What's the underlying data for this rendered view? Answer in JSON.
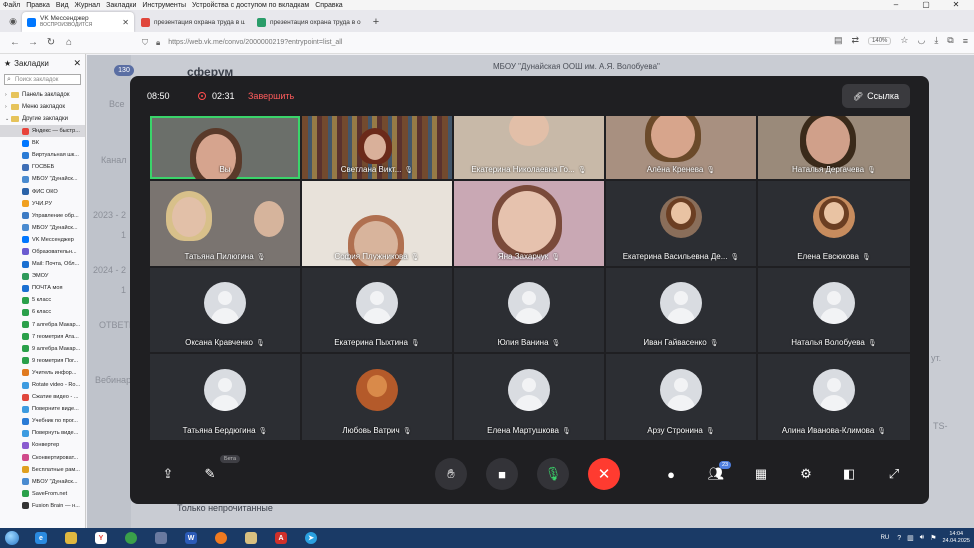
{
  "menubar": {
    "items": [
      "Файл",
      "Правка",
      "Вид",
      "Журнал",
      "Закладки",
      "Инструменты",
      "Устройства с доступом по вкладкам",
      "Справка"
    ]
  },
  "tabs": [
    {
      "title": "VK Мессенджер",
      "subtitle": "ВОСПРОИЗВОДИТСЯ",
      "color": "#0077ff"
    },
    {
      "title": "презентация охрана труда в ш...",
      "subtitle": "",
      "color": "#e0463c"
    },
    {
      "title": "презентация охрана труда в ош...",
      "subtitle": "",
      "color": "#2a9d6a"
    }
  ],
  "navbar": {
    "url": "https://web.vk.me/convo/2000000219?entrypoint=list_all",
    "zoom": "140%"
  },
  "sidebar": {
    "title": "Закладки",
    "search_placeholder": "Поиск закладок",
    "folders": [
      "Панель закладок",
      "Меню закладок",
      "Другие закладки"
    ],
    "items": [
      {
        "label": "Яндекс — быстр...",
        "color": "#e8433a"
      },
      {
        "label": "ВК",
        "color": "#0077ff"
      },
      {
        "label": "Виртуальная шк...",
        "color": "#2a7bd5"
      },
      {
        "label": "ГОСВЕБ",
        "color": "#3f6fb5"
      },
      {
        "label": "МБОУ \"Дунайск...",
        "color": "#4a8bd0"
      },
      {
        "label": "ФИС ОКО",
        "color": "#2b63a8"
      },
      {
        "label": "УЧИ.РУ",
        "color": "#f0a020"
      },
      {
        "label": "Управление обр...",
        "color": "#3d7bc4"
      },
      {
        "label": "МБОУ \"Дунайск...",
        "color": "#4a8bd0"
      },
      {
        "label": "VK Мессенджер",
        "color": "#0077ff"
      },
      {
        "label": "Образовательн...",
        "color": "#6b5bd0"
      },
      {
        "label": "Mail: Почта, Обл...",
        "color": "#1a6fd1"
      },
      {
        "label": "ЭМОУ",
        "color": "#2f9a5a"
      },
      {
        "label": "ПОЧТА моя",
        "color": "#1a6fd1"
      },
      {
        "label": "5 класс",
        "color": "#2aa04a"
      },
      {
        "label": "6 класс",
        "color": "#2aa04a"
      },
      {
        "label": "7 алгебра Макар...",
        "color": "#2aa04a"
      },
      {
        "label": "7 геометрия Ата...",
        "color": "#2aa04a"
      },
      {
        "label": "9 алгебра Макар...",
        "color": "#2aa04a"
      },
      {
        "label": "9 геометрия Пог...",
        "color": "#2aa04a"
      },
      {
        "label": "Учитель инфор...",
        "color": "#e07a20"
      },
      {
        "label": "Rotate video - Ro...",
        "color": "#3d9be0"
      },
      {
        "label": "Сжатие видео - ...",
        "color": "#e0463c"
      },
      {
        "label": "Поверните виде...",
        "color": "#3d9be0"
      },
      {
        "label": "Учебник по прог...",
        "color": "#2a7bd5"
      },
      {
        "label": "Повернуть виде...",
        "color": "#3d9be0"
      },
      {
        "label": "Конвертер",
        "color": "#8a5bd0"
      },
      {
        "label": "Сконвертироват...",
        "color": "#d04a8a"
      },
      {
        "label": "Бесплатные рам...",
        "color": "#e0a020"
      },
      {
        "label": "МБОУ \"Дунайск...",
        "color": "#4a8bd0"
      },
      {
        "label": "SaveFrom.net",
        "color": "#2aa04a"
      },
      {
        "label": "Fusion Brain — н...",
        "color": "#333333"
      }
    ]
  },
  "vk": {
    "unread": "130",
    "logo": "сферум",
    "chat_title": "МБОУ \"Дунайская ООШ им. А.Я. Волобуева\"",
    "ghost_all": "Все",
    "ghost_channels": "Канал",
    "ghost_2023": "2023 - 2",
    "ghost_2024": "2024 - 2",
    "ghost_answers": "ОТВЕТЕ",
    "ghost_webinar": "Вебинар",
    "ghost_1": "1",
    "ghost_2": "1",
    "ghost_right1": "ут.",
    "ghost_right2": "TS-",
    "bottom_text": "Только непрочитанные"
  },
  "call": {
    "clock": "08:50",
    "timer": "02:31",
    "finish_label": "Завершить",
    "link_label": "Ссылка",
    "beta_label": "Бета",
    "participants_count": "23",
    "participants": [
      {
        "name": "Вы",
        "kind": "video"
      },
      {
        "name": "Светлана Викт...",
        "kind": "video"
      },
      {
        "name": "Екатерина Николаевна Го...",
        "kind": "video"
      },
      {
        "name": "Алёна Кренева",
        "kind": "video"
      },
      {
        "name": "Наталья Дергачева",
        "kind": "video"
      },
      {
        "name": "Татьяна Пилюгина",
        "kind": "video"
      },
      {
        "name": "София Плужникова",
        "kind": "video"
      },
      {
        "name": "Яна Захарчук",
        "kind": "video"
      },
      {
        "name": "Екатерина Васильевна Де...",
        "kind": "photo"
      },
      {
        "name": "Елена Евсюкова",
        "kind": "photo"
      },
      {
        "name": "Оксана Кравченко",
        "kind": "placeholder"
      },
      {
        "name": "Екатерина Пыхтина",
        "kind": "placeholder"
      },
      {
        "name": "Юлия Ванина",
        "kind": "placeholder"
      },
      {
        "name": "Иван Гайвасенко",
        "kind": "placeholder"
      },
      {
        "name": "Наталья Волобуева",
        "kind": "placeholder"
      },
      {
        "name": "Татьяна Бердюгина",
        "kind": "placeholder"
      },
      {
        "name": "Любовь Ватрич",
        "kind": "cat"
      },
      {
        "name": "Елена Мартушкова",
        "kind": "placeholder"
      },
      {
        "name": "Арзу Стронина",
        "kind": "placeholder"
      },
      {
        "name": "Алина Иванова-Климова",
        "kind": "placeholder"
      }
    ]
  },
  "taskbar": {
    "lang": "RU",
    "time": "14:04",
    "date": "24.04.2025"
  }
}
